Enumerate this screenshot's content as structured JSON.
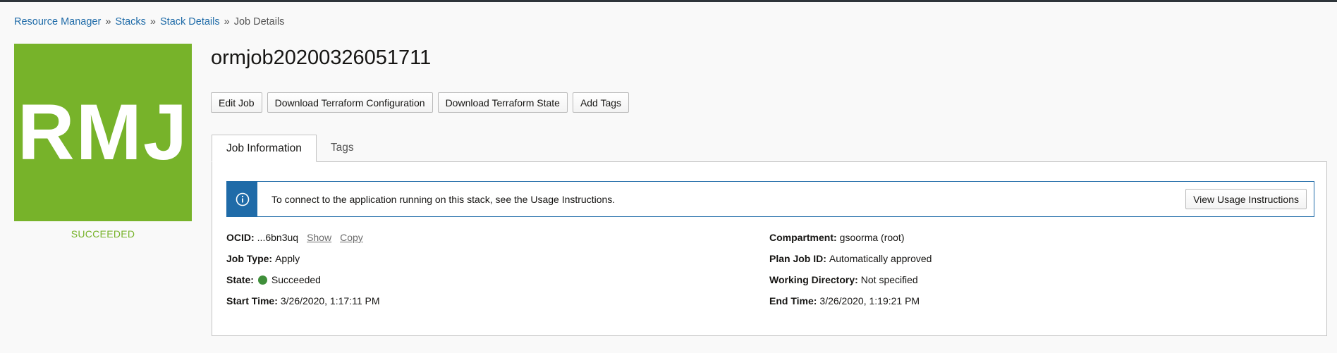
{
  "breadcrumb": {
    "items": [
      "Resource Manager",
      "Stacks",
      "Stack Details"
    ],
    "current": "Job Details",
    "separator": "»"
  },
  "badge": {
    "text": "RMJ",
    "status": "SUCCEEDED",
    "color": "#77b32a"
  },
  "page": {
    "title": "ormjob20200326051711"
  },
  "actions": {
    "edit": "Edit Job",
    "download_config": "Download Terraform Configuration",
    "download_state": "Download Terraform State",
    "add_tags": "Add Tags"
  },
  "tabs": [
    {
      "label": "Job Information",
      "active": true
    },
    {
      "label": "Tags",
      "active": false
    }
  ],
  "banner": {
    "icon": "info-icon",
    "text": "To connect to the application running on this stack, see the Usage Instructions.",
    "button": "View Usage Instructions",
    "accent": "#1f6ba8"
  },
  "details": {
    "ocid": {
      "label": "OCID:",
      "value": "...6bn3uq",
      "show": "Show",
      "copy": "Copy"
    },
    "job_type": {
      "label": "Job Type:",
      "value": "Apply"
    },
    "state": {
      "label": "State:",
      "value": "Succeeded",
      "color": "#3f8f3a"
    },
    "start_time": {
      "label": "Start Time:",
      "value": "3/26/2020, 1:17:11 PM"
    },
    "compartment": {
      "label": "Compartment:",
      "value": "gsoorma (root)"
    },
    "plan_job_id": {
      "label": "Plan Job ID:",
      "value": "Automatically approved"
    },
    "working_directory": {
      "label": "Working Directory:",
      "value": "Not specified"
    },
    "end_time": {
      "label": "End Time:",
      "value": "3/26/2020, 1:19:21 PM"
    }
  }
}
